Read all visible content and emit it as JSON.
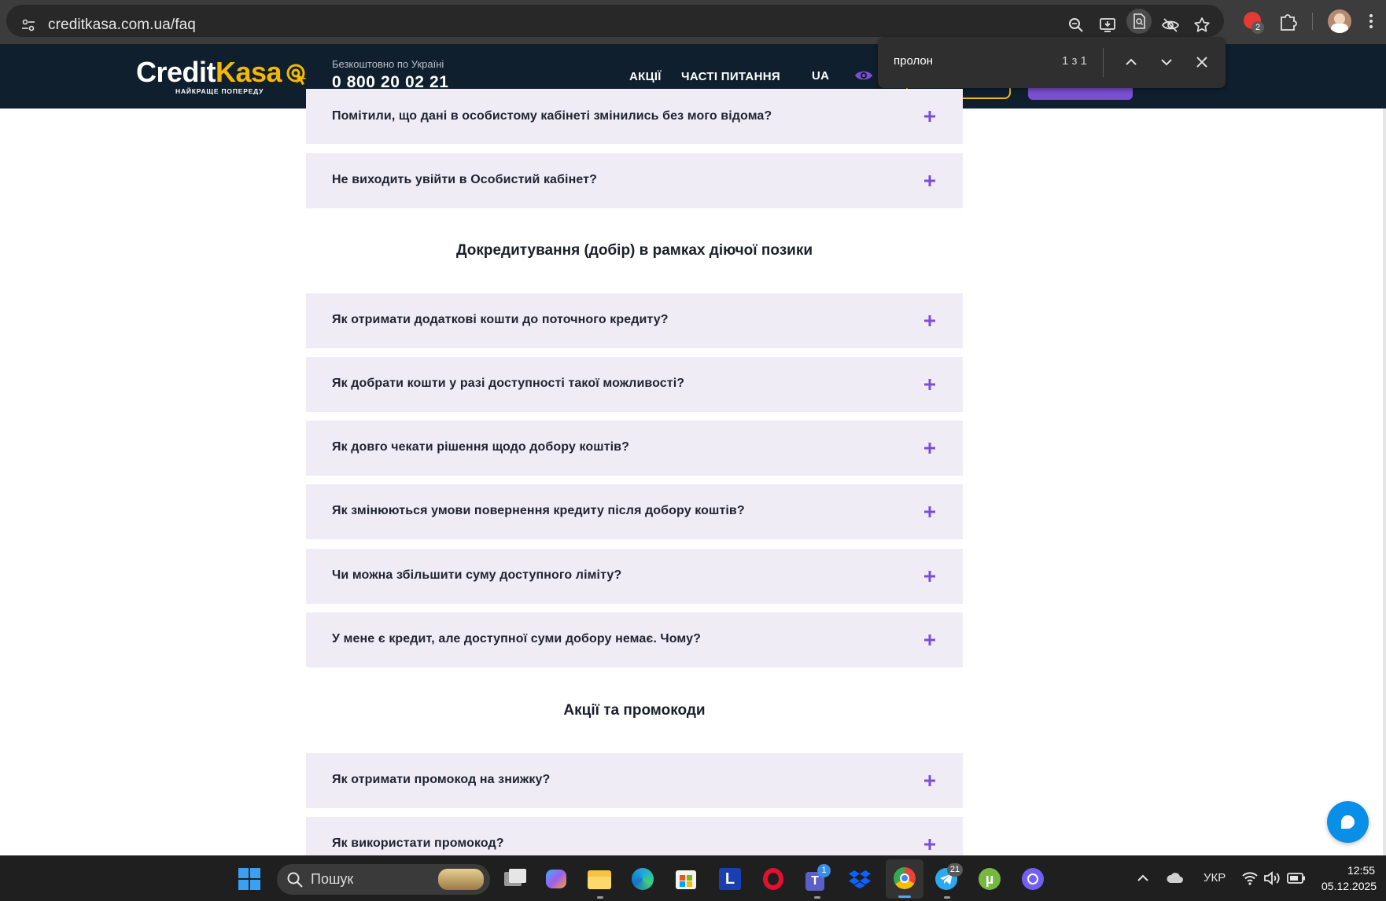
{
  "browser": {
    "url": "creditkasa.com.ua/faq",
    "find": {
      "query": "пролон",
      "count": "1 з 1"
    },
    "extension_badge": "2"
  },
  "site": {
    "logo": {
      "part1": "Credit",
      "part2": "Kasa",
      "tagline": "НАЙКРАЩЕ ПОПЕРЕДУ"
    },
    "free_label": "Безкоштовно по Україні",
    "phone": "0 800 20 02 21",
    "nav": {
      "promo": "АКЦІЇ",
      "faq": "ЧАСТІ ПИТАННЯ",
      "lang": "UA"
    }
  },
  "faq": {
    "top_items": [
      "Помітили, що дані в особистому кабінеті змінились без мого відома?",
      "Не виходить увійти в Особистий кабінет?"
    ],
    "section1": {
      "title": "Докредитування (добір) в рамках діючої позики",
      "items": [
        "Як отримати додаткові кошти до поточного кредиту?",
        "Як добрати кошти у разі доступності такої можливості?",
        "Як довго чекати рішення щодо добору коштів?",
        "Як змінюються умови повернення кредиту після добору коштів?",
        "Чи можна збільшити суму доступного ліміту?",
        "У мене є кредит, але доступної суми добору немає. Чому?"
      ]
    },
    "section2": {
      "title": "Акції та промокоди",
      "items": [
        "Як отримати промокод на знижку?",
        "Як використати промокод?"
      ]
    }
  },
  "taskbar": {
    "search": "Пошук",
    "teams_badge": "1",
    "telegram_badge": "21",
    "language": "УКР",
    "time": "12:55",
    "date": "05.12.2025"
  },
  "colors": {
    "header_bg": "#0f1f2e",
    "accent_yellow": "#f5b800",
    "accent_purple": "#7a4fd0",
    "faq_bg": "#efecf6"
  }
}
